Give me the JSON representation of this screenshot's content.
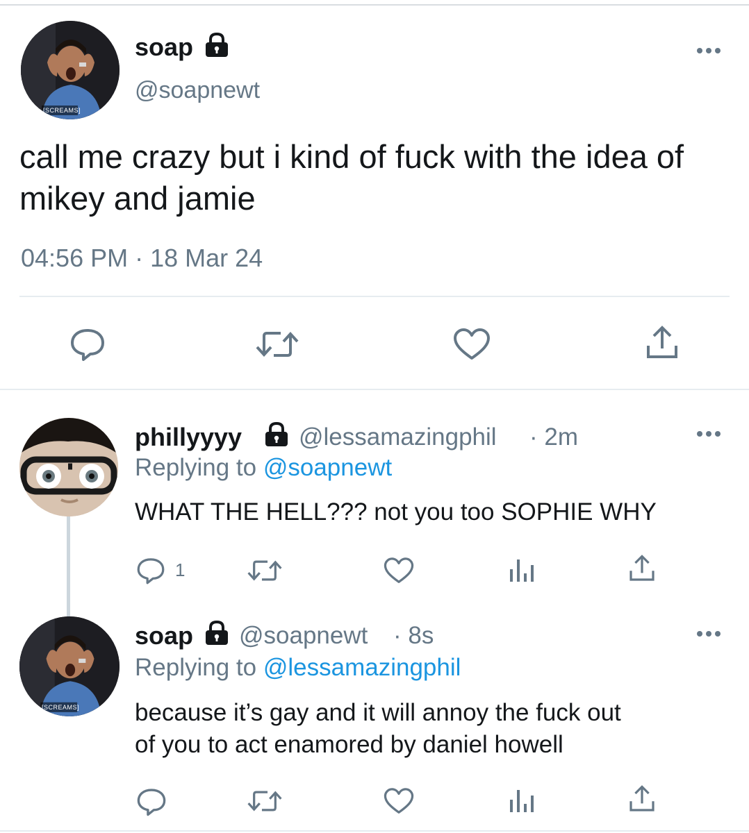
{
  "main_tweet": {
    "display_name": "soap",
    "handle": "@soapnewt",
    "avatar_caption": "[SCREAMS]",
    "text": "call me crazy but i kind of fuck with the idea of mikey and jamie",
    "timestamp": "04:56 PM · 18 Mar 24",
    "actions": [
      "reply-icon",
      "retweet-icon",
      "like-icon",
      "share-icon"
    ]
  },
  "reply_1": {
    "display_name": "phillyyyy",
    "handle": "@lessamazingphil",
    "time": "· 2m",
    "replying_prefix": "Replying to",
    "replying_handle": "@soapnewt",
    "text": "WHAT THE HELL??? not you too SOPHIE WHY",
    "reply_count": "1",
    "actions": [
      "reply-icon",
      "retweet-icon",
      "like-icon",
      "analytics-icon",
      "share-icon"
    ]
  },
  "reply_2": {
    "display_name": "soap",
    "handle": "@soapnewt",
    "time": "· 8s",
    "avatar_caption": "[SCREAMS]",
    "replying_prefix": "Replying to",
    "replying_handle": "@lessamazingphil",
    "text_line1": "because it’s gay and it will annoy the fuck out",
    "text_line2": "of you to act enamored by daniel howell",
    "actions": [
      "reply-icon",
      "retweet-icon",
      "like-icon",
      "analytics-icon",
      "share-icon"
    ]
  },
  "colors": {
    "link": "#1b95e0",
    "secondary_text": "#657786",
    "divider": "#e6ecf0",
    "thread_line": "#ccd6dd"
  }
}
